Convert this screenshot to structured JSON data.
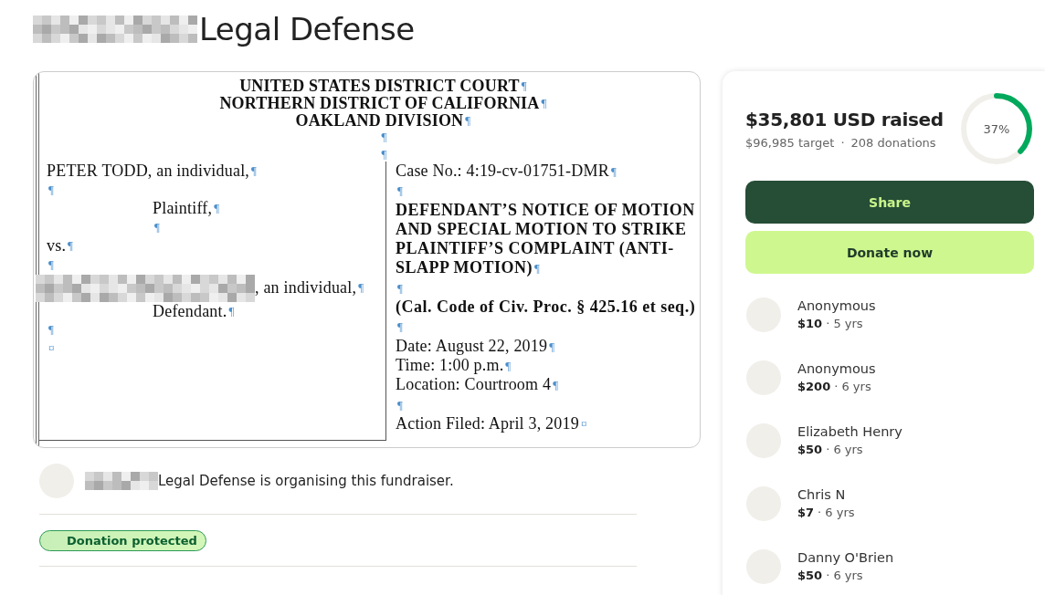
{
  "title": "Legal Defense",
  "document": {
    "header": [
      {
        "text": "UNITED STATES DISTRICT COURT",
        "mark": "¶"
      },
      {
        "text": "NORTHERN DISTRICT OF CALIFORNIA",
        "mark": "¶"
      },
      {
        "text": "OAKLAND DIVISION",
        "mark": "¶"
      },
      {
        "mark": "¶"
      },
      {
        "mark": "¶"
      }
    ],
    "left": [
      {
        "kind": "plain",
        "text": "PETER TODD, an individual,",
        "mark": "¶"
      },
      {
        "kind": "plain",
        "mark": "¶"
      },
      {
        "kind": "indent",
        "text": "Plaintiff,",
        "mark": "¶"
      },
      {
        "kind": "indent",
        "mark": "¶"
      },
      {
        "kind": "plain",
        "text": "vs.",
        "mark": "¶"
      },
      {
        "kind": "plain",
        "mark": "¶"
      },
      {
        "kind": "redacted",
        "text": ", an individual,",
        "mark": "¶"
      },
      {
        "kind": "indent",
        "text": "Defendant.",
        "mark": "¶"
      },
      {
        "kind": "plain",
        "mark": "¶"
      },
      {
        "kind": "plain",
        "mark": "¤"
      }
    ],
    "right": [
      {
        "kind": "plain",
        "text": "Case No.: 4:19-cv-01751-DMR",
        "mark": "¶"
      },
      {
        "kind": "plain",
        "mark": "¶"
      },
      {
        "kind": "bold",
        "text": "DEFENDANT’S NOTICE OF MOTION"
      },
      {
        "kind": "bold",
        "text": "AND SPECIAL MOTION TO STRIKE"
      },
      {
        "kind": "bold",
        "text": "PLAINTIFF’S COMPLAINT (ANTI-"
      },
      {
        "kind": "bold",
        "text": "SLAPP MOTION)",
        "mark": "¶"
      },
      {
        "kind": "plain",
        "mark": "¶"
      },
      {
        "kind": "bold",
        "text": "(Cal. Code of Civ. Proc. § 425.16 et seq.)"
      },
      {
        "kind": "plain",
        "mark": "¶"
      },
      {
        "kind": "plain",
        "text": "Date:  August 22, 2019",
        "mark": "¶"
      },
      {
        "kind": "plain",
        "text": "Time: 1:00 p.m.",
        "mark": "¶"
      },
      {
        "kind": "plain",
        "text": "Location: Courtroom 4",
        "mark": "¶"
      },
      {
        "kind": "plain",
        "mark": "¶"
      },
      {
        "kind": "plain",
        "text": "Action Filed: April 3, 2019",
        "mark": "¤"
      }
    ]
  },
  "organiser": {
    "text": "Legal Defense is organising this fundraiser."
  },
  "badge": {
    "label": "Donation protected"
  },
  "campaign": {
    "raised": "$35,801 USD raised",
    "target": "$96,985 target",
    "separator": "·",
    "donations": "208 donations",
    "percent": "37%",
    "level": 0.37
  },
  "buttons": [
    {
      "label": "Share",
      "kind": "primary"
    },
    {
      "label": "Donate now",
      "kind": "accent"
    }
  ],
  "donors": [
    {
      "name": "Anonymous",
      "amount": "$10",
      "age": "· 5 yrs"
    },
    {
      "name": "Anonymous",
      "amount": "$200",
      "age": "· 6 yrs"
    },
    {
      "name": "Elizabeth Henry",
      "amount": "$50",
      "age": "· 6 yrs"
    },
    {
      "name": "Chris N",
      "amount": "$7",
      "age": "· 6 yrs"
    },
    {
      "name": "Danny O'Brien",
      "amount": "$50",
      "age": "· 6 yrs"
    }
  ]
}
